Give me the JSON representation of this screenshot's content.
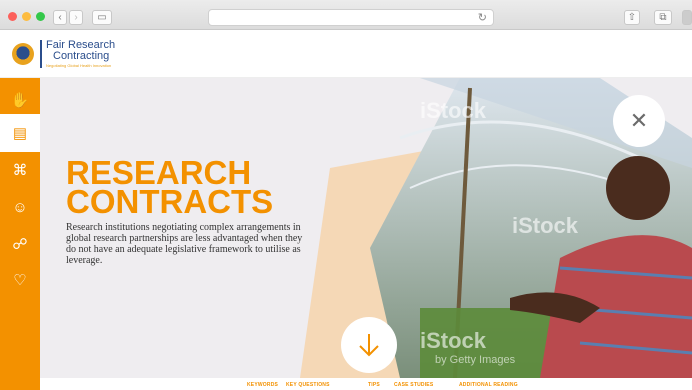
{
  "colors": {
    "accent": "#f39100",
    "brand_blue": "#2b4e8c"
  },
  "logo": {
    "line1": "Fair Research",
    "line2": "Contracting",
    "tagline": "Negotiating Global Health Innovation"
  },
  "hero": {
    "title_line1": "RESEARCH",
    "title_line2": "CONTRACTS",
    "description": "Research institutions negotiating complex arrangements in global research partnerships are less advantaged when they do not have an adequate legislative framework to utilise as leverage.",
    "watermark": "iStock",
    "watermark_sub": "by Getty Images"
  },
  "sidebar": {
    "items": [
      "handshake-icon",
      "document-icon",
      "network-icon",
      "head-icon",
      "handshake-icon",
      "heart-hands-icon"
    ]
  },
  "nav": {
    "items": [
      "KEYWORDS",
      "KEY QUESTIONS",
      "TIPS",
      "CASE STUDIES",
      "ADDITIONAL READING"
    ]
  }
}
